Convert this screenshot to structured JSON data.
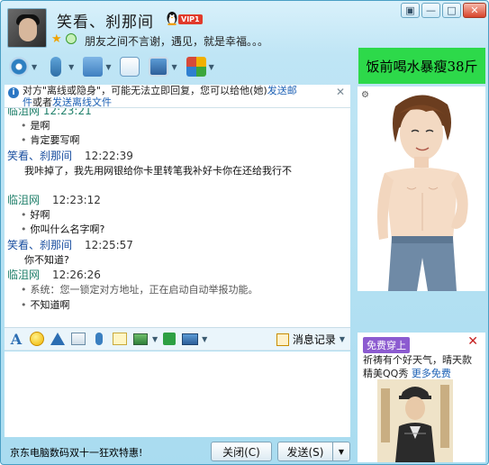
{
  "header": {
    "contact_name": "笑看、刹那间",
    "vip_label": "VIP1",
    "signature": "朋友之间不言谢，遇见，就是幸福。。。"
  },
  "window_controls": [
    "▣",
    "—",
    "□",
    "✕"
  ],
  "toolbar": {
    "items": [
      "video-call",
      "voice-call",
      "send-file",
      "send-sms",
      "remote-assist",
      "apps"
    ]
  },
  "ad_top": {
    "text": "饭前喝水暴瘦38斤"
  },
  "notice": {
    "text_part1": "对方\"离线或隐身\"，可能无法立即回复，您可以给他(她)",
    "link1": "发送邮",
    "text_part2_prefix": "件",
    "text_part2_mid": "或者",
    "link2": "发送离线文件"
  },
  "chat": {
    "messages": [
      {
        "type": "cut",
        "text": "临沮网   12:23:21"
      },
      {
        "type": "bullet",
        "text": "是啊"
      },
      {
        "type": "bullet",
        "text": "肯定要写啊"
      },
      {
        "type": "sender",
        "name": "笑看、刹那间",
        "time": "12:22:39",
        "self": true
      },
      {
        "type": "plain",
        "text": "我咔掉了，我先用网银给你卡里转笔我补好卡你在还给我行不"
      },
      {
        "type": "sender",
        "name": "临沮网",
        "time": "12:23:12",
        "self": false
      },
      {
        "type": "bullet",
        "text": "好啊"
      },
      {
        "type": "bullet",
        "text": "你叫什么名字啊?"
      },
      {
        "type": "sender",
        "name": "笑看、刹那间",
        "time": "12:25:57",
        "self": true
      },
      {
        "type": "plain",
        "text": "你不知道?"
      },
      {
        "type": "sender",
        "name": "临沮网",
        "time": "12:26:26",
        "self": false
      },
      {
        "type": "system",
        "text": "系统：您一锁定对方地址，正在启动自动举报功能。"
      },
      {
        "type": "bullet",
        "text": "不知道啊"
      }
    ]
  },
  "input_toolbar": {
    "message_record_label": "消息记录"
  },
  "bottom": {
    "promo_text": "京东电脑数码双十一狂欢特惠!",
    "close_label": "关闭(C)",
    "send_label": "发送(S)"
  },
  "ad_bottom": {
    "tag": "免费穿上",
    "line1": "祈祷有个好天气，晴天款",
    "line2_prefix": "精美QQ秀 ",
    "line2_link": "更多免费"
  }
}
